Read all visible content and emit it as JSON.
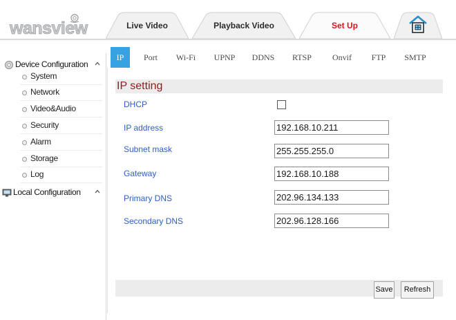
{
  "header": {
    "logo_text": "wansview",
    "tabs": [
      {
        "label": "Live Video",
        "active": false
      },
      {
        "label": "Playback Video",
        "active": false
      },
      {
        "label": "Set Up",
        "active": true
      }
    ],
    "home_icon": "house-icon"
  },
  "sidebar": {
    "device_group": {
      "label": "Device Configuration",
      "icon": "gear-icon"
    },
    "device_items": [
      "System",
      "Network",
      "Video&Audio",
      "Security",
      "Alarm",
      "Storage",
      "Log"
    ],
    "local_group": {
      "label": "Local Configuration",
      "icon": "monitor-icon"
    }
  },
  "subtabs": {
    "items": [
      "IP",
      "Port",
      "Wi-Fi",
      "UPNP",
      "DDNS",
      "RTSP",
      "Onvif",
      "FTP",
      "SMTP"
    ],
    "active": "IP"
  },
  "form": {
    "section_title": "IP setting",
    "dhcp": {
      "label": "DHCP",
      "checked": false
    },
    "fields": [
      {
        "label": "IP address",
        "value": "192.168.10.211"
      },
      {
        "label": "Subnet mask",
        "value": "255.255.255.0"
      },
      {
        "label": "Gateway",
        "value": "192.168.10.188"
      },
      {
        "label": "Primary DNS",
        "value": "202.96.134.133"
      },
      {
        "label": "Secondary DNS",
        "value": "202.96.128.166"
      }
    ],
    "save_label": "Save",
    "refresh_label": "Refresh"
  },
  "colors": {
    "accent_blue": "#37a2e1",
    "active_tab_text": "#d3151d",
    "field_label": "#2c5fc7",
    "section_title": "#8f1c1c"
  }
}
